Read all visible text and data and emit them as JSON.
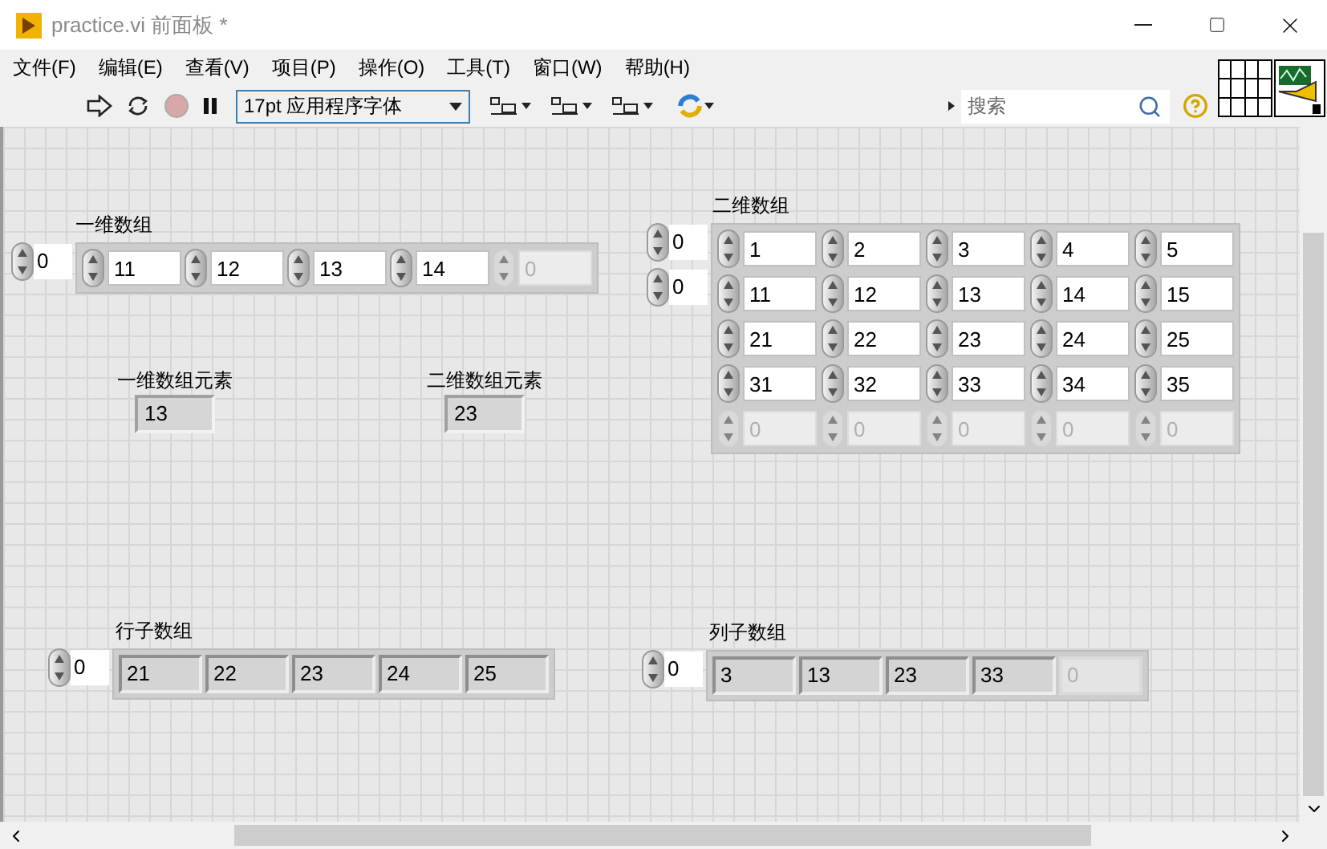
{
  "window": {
    "title": "practice.vi 前面板 *"
  },
  "menu": [
    {
      "label": "文件(F)"
    },
    {
      "label": "编辑(E)"
    },
    {
      "label": "查看(V)"
    },
    {
      "label": "项目(P)"
    },
    {
      "label": "操作(O)"
    },
    {
      "label": "工具(T)"
    },
    {
      "label": "窗口(W)"
    },
    {
      "label": "帮助(H)"
    }
  ],
  "toolbar": {
    "font_select": "17pt 应用程序字体",
    "search": {
      "placeholder": "搜索"
    }
  },
  "panel": [
    {
      "kind": "array",
      "label": "一维数组",
      "indices": [
        "0"
      ],
      "elements": [
        {
          "value": "11",
          "disabled": false
        },
        {
          "value": "12",
          "disabled": false
        },
        {
          "value": "13",
          "disabled": false
        },
        {
          "value": "14",
          "disabled": false
        },
        {
          "value": "0",
          "disabled": true
        }
      ]
    },
    {
      "kind": "indicator",
      "label": "一维数组元素",
      "value": "13"
    },
    {
      "kind": "indicator",
      "label": "二维数组元素",
      "value": "23"
    },
    {
      "kind": "matrix",
      "label": "二维数组",
      "indices": [
        "0",
        "0"
      ],
      "rows": [
        [
          {
            "value": "1",
            "disabled": false
          },
          {
            "value": "2",
            "disabled": false
          },
          {
            "value": "3",
            "disabled": false
          },
          {
            "value": "4",
            "disabled": false
          },
          {
            "value": "5",
            "disabled": false
          }
        ],
        [
          {
            "value": "11",
            "disabled": false
          },
          {
            "value": "12",
            "disabled": false
          },
          {
            "value": "13",
            "disabled": false
          },
          {
            "value": "14",
            "disabled": false
          },
          {
            "value": "15",
            "disabled": false
          }
        ],
        [
          {
            "value": "21",
            "disabled": false
          },
          {
            "value": "22",
            "disabled": false
          },
          {
            "value": "23",
            "disabled": false
          },
          {
            "value": "24",
            "disabled": false
          },
          {
            "value": "25",
            "disabled": false
          }
        ],
        [
          {
            "value": "31",
            "disabled": false
          },
          {
            "value": "32",
            "disabled": false
          },
          {
            "value": "33",
            "disabled": false
          },
          {
            "value": "34",
            "disabled": false
          },
          {
            "value": "35",
            "disabled": false
          }
        ],
        [
          {
            "value": "0",
            "disabled": true
          },
          {
            "value": "0",
            "disabled": true
          },
          {
            "value": "0",
            "disabled": true
          },
          {
            "value": "0",
            "disabled": true
          },
          {
            "value": "0",
            "disabled": true
          }
        ]
      ]
    },
    {
      "kind": "indicator_array",
      "label": "行子数组",
      "indices": [
        "0"
      ],
      "elements": [
        {
          "value": "21",
          "disabled": false
        },
        {
          "value": "22",
          "disabled": false
        },
        {
          "value": "23",
          "disabled": false
        },
        {
          "value": "24",
          "disabled": false
        },
        {
          "value": "25",
          "disabled": false
        }
      ]
    },
    {
      "kind": "indicator_array",
      "label": "列子数组",
      "indices": [
        "0"
      ],
      "elements": [
        {
          "value": "3",
          "disabled": false
        },
        {
          "value": "13",
          "disabled": false
        },
        {
          "value": "23",
          "disabled": false
        },
        {
          "value": "33",
          "disabled": false
        },
        {
          "value": "0",
          "disabled": true
        }
      ]
    }
  ]
}
